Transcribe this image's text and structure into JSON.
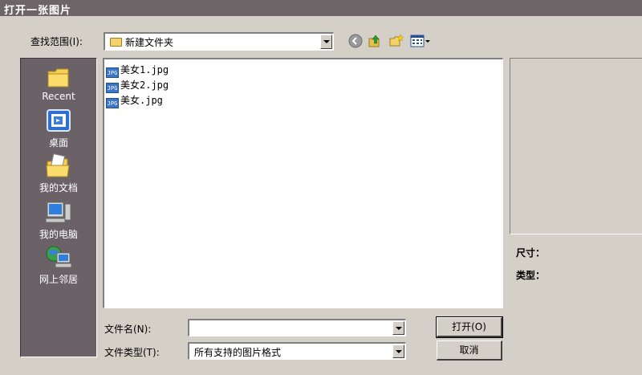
{
  "window": {
    "title": "打开一张图片"
  },
  "lookin": {
    "label": "查找范围(I):",
    "value": "新建文件夹"
  },
  "places": [
    {
      "label": "Recent",
      "icon": "recent-folder-icon"
    },
    {
      "label": "桌面",
      "icon": "desktop-icon"
    },
    {
      "label": "我的文档",
      "icon": "my-documents-icon"
    },
    {
      "label": "我的电脑",
      "icon": "my-computer-icon"
    },
    {
      "label": "网上邻居",
      "icon": "network-places-icon"
    }
  ],
  "files": [
    {
      "name": "美女1.jpg",
      "badge": "JPG"
    },
    {
      "name": "美女2.jpg",
      "badge": "JPG"
    },
    {
      "name": "美女.jpg",
      "badge": "JPG"
    }
  ],
  "info": {
    "size_label": "尺寸：",
    "type_label": "类型："
  },
  "filename": {
    "label": "文件名(N):",
    "value": ""
  },
  "filetype": {
    "label": "文件类型(T):",
    "value": "所有支持的图片格式"
  },
  "buttons": {
    "open": "打开(O)",
    "cancel": "取消"
  },
  "colors": {
    "titlebar": "#6d6468",
    "places_bar": "#6a6267",
    "dialog_bg": "#d4d0c8"
  }
}
